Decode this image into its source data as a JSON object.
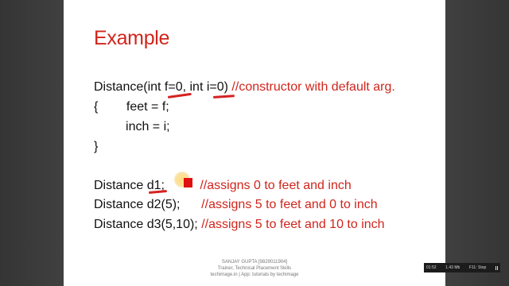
{
  "slide": {
    "title": "Example",
    "lines": [
      {
        "code": "Distance(int f=0, int i=0) ",
        "comment": "//constructor with default arg."
      },
      {
        "code": "{        feet = f;",
        "comment": ""
      },
      {
        "code": "         inch = i;",
        "comment": ""
      },
      {
        "code": "}",
        "comment": ""
      },
      {
        "code": "Distance d1;          ",
        "comment": "//assigns 0 to feet and inch"
      },
      {
        "code": "Distance d2(5);      ",
        "comment": "//assigns 5 to feet and 0 to inch"
      },
      {
        "code": "Distance d3(5,10); ",
        "comment": "//assigns 5 to feet and 10 to inch"
      }
    ]
  },
  "footer": {
    "name": "SANJAY GUPTA [9829011904]",
    "role": "Trainer, Technical Placement Skills",
    "site": "techimage.in | App: tutorials by techimage"
  },
  "recorder": {
    "time": "01:52",
    "size": "1.43 Mb",
    "stop_hint": "F11: Stop"
  },
  "colors": {
    "accent": "#d0251c",
    "annotation": "#e01010"
  }
}
